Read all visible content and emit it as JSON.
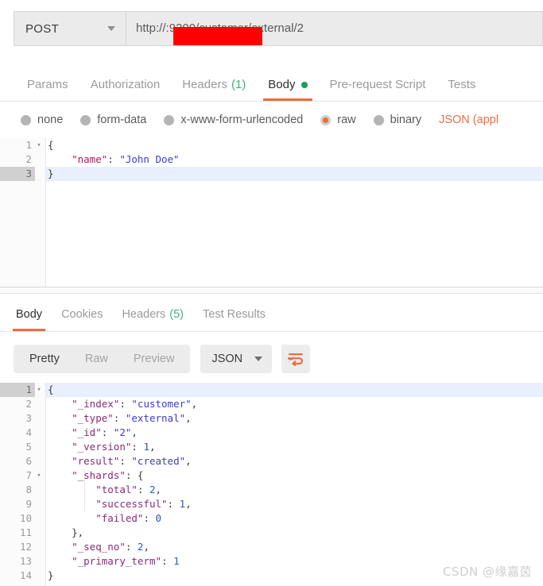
{
  "request_bar": {
    "method": "POST",
    "method_caret_icon": "chevron-down-icon",
    "url_prefix": "http://",
    "url_host_redacted": "",
    "url_suffix": ":9200/customer/external/2",
    "redaction_color": "#ff0000"
  },
  "request_tabs": [
    {
      "label": "Params",
      "active": false
    },
    {
      "label": "Authorization",
      "active": false
    },
    {
      "label": "Headers",
      "count": "(1)",
      "active": false
    },
    {
      "label": "Body",
      "dot": true,
      "active": true
    },
    {
      "label": "Pre-request Script",
      "active": false
    },
    {
      "label": "Tests",
      "active": false
    }
  ],
  "body_types": [
    {
      "label": "none",
      "checked": false
    },
    {
      "label": "form-data",
      "checked": false
    },
    {
      "label": "x-www-form-urlencoded",
      "checked": false
    },
    {
      "label": "raw",
      "checked": true
    },
    {
      "label": "binary",
      "checked": false
    }
  ],
  "body_content_type": "JSON (appl",
  "request_body": {
    "lines": [
      {
        "num": "1",
        "fold": "▾",
        "active": false,
        "tokens": [
          {
            "t": "{",
            "c": "t-punc"
          }
        ]
      },
      {
        "num": "2",
        "fold": "",
        "active": false,
        "tokens": [
          {
            "t": "    ",
            "c": "t-punc"
          },
          {
            "t": "\"name\"",
            "c": "t-key-req"
          },
          {
            "t": ": ",
            "c": "t-punc"
          },
          {
            "t": "\"John Doe\"",
            "c": "t-str-req"
          }
        ]
      },
      {
        "num": "3",
        "fold": "",
        "active": true,
        "tokens": [
          {
            "t": "}",
            "c": "t-punc"
          }
        ]
      }
    ]
  },
  "response_tabs": [
    {
      "label": "Body",
      "active": true
    },
    {
      "label": "Cookies",
      "active": false
    },
    {
      "label": "Headers",
      "count": "(5)",
      "active": false
    },
    {
      "label": "Test Results",
      "active": false
    }
  ],
  "response_toolbar": {
    "segments": [
      {
        "label": "Pretty",
        "active": true
      },
      {
        "label": "Raw",
        "active": false
      },
      {
        "label": "Preview",
        "active": false
      }
    ],
    "format": "JSON",
    "format_caret_icon": "chevron-down-icon",
    "wrap_button_icon": "word-wrap-icon",
    "wrap_icon_color": "#ef6c3f"
  },
  "response_body": {
    "lines": [
      {
        "num": "1",
        "fold": "▾",
        "active": true,
        "tokens": [
          {
            "t": "{",
            "c": "t-punc"
          }
        ]
      },
      {
        "num": "2",
        "fold": "",
        "active": false,
        "tokens": [
          {
            "t": "    ",
            "c": "t-punc"
          },
          {
            "t": "\"_index\"",
            "c": "t-key-res"
          },
          {
            "t": ": ",
            "c": "t-punc"
          },
          {
            "t": "\"customer\"",
            "c": "t-val-res"
          },
          {
            "t": ",",
            "c": "t-punc"
          }
        ]
      },
      {
        "num": "3",
        "fold": "",
        "active": false,
        "tokens": [
          {
            "t": "    ",
            "c": "t-punc"
          },
          {
            "t": "\"_type\"",
            "c": "t-key-res"
          },
          {
            "t": ": ",
            "c": "t-punc"
          },
          {
            "t": "\"external\"",
            "c": "t-val-res"
          },
          {
            "t": ",",
            "c": "t-punc"
          }
        ]
      },
      {
        "num": "4",
        "fold": "",
        "active": false,
        "tokens": [
          {
            "t": "    ",
            "c": "t-punc"
          },
          {
            "t": "\"_id\"",
            "c": "t-key-res"
          },
          {
            "t": ": ",
            "c": "t-punc"
          },
          {
            "t": "\"2\"",
            "c": "t-val-res"
          },
          {
            "t": ",",
            "c": "t-punc"
          }
        ]
      },
      {
        "num": "5",
        "fold": "",
        "active": false,
        "tokens": [
          {
            "t": "    ",
            "c": "t-punc"
          },
          {
            "t": "\"_version\"",
            "c": "t-key-res"
          },
          {
            "t": ": ",
            "c": "t-punc"
          },
          {
            "t": "1",
            "c": "t-num"
          },
          {
            "t": ",",
            "c": "t-punc"
          }
        ]
      },
      {
        "num": "6",
        "fold": "",
        "active": false,
        "tokens": [
          {
            "t": "    ",
            "c": "t-punc"
          },
          {
            "t": "\"result\"",
            "c": "t-key-res"
          },
          {
            "t": ": ",
            "c": "t-punc"
          },
          {
            "t": "\"created\"",
            "c": "t-val-res"
          },
          {
            "t": ",",
            "c": "t-punc"
          }
        ]
      },
      {
        "num": "7",
        "fold": "▾",
        "active": false,
        "tokens": [
          {
            "t": "    ",
            "c": "t-punc"
          },
          {
            "t": "\"_shards\"",
            "c": "t-key-res"
          },
          {
            "t": ": {",
            "c": "t-punc"
          }
        ]
      },
      {
        "num": "8",
        "fold": "",
        "active": false,
        "tokens": [
          {
            "t": "        ",
            "c": "t-punc"
          },
          {
            "t": "\"total\"",
            "c": "t-key-res"
          },
          {
            "t": ": ",
            "c": "t-punc"
          },
          {
            "t": "2",
            "c": "t-num"
          },
          {
            "t": ",",
            "c": "t-punc"
          }
        ]
      },
      {
        "num": "9",
        "fold": "",
        "active": false,
        "tokens": [
          {
            "t": "        ",
            "c": "t-punc"
          },
          {
            "t": "\"successful\"",
            "c": "t-key-res"
          },
          {
            "t": ": ",
            "c": "t-punc"
          },
          {
            "t": "1",
            "c": "t-num"
          },
          {
            "t": ",",
            "c": "t-punc"
          }
        ]
      },
      {
        "num": "10",
        "fold": "",
        "active": false,
        "tokens": [
          {
            "t": "        ",
            "c": "t-punc"
          },
          {
            "t": "\"failed\"",
            "c": "t-key-res"
          },
          {
            "t": ": ",
            "c": "t-punc"
          },
          {
            "t": "0",
            "c": "t-num"
          }
        ]
      },
      {
        "num": "11",
        "fold": "",
        "active": false,
        "tokens": [
          {
            "t": "    },",
            "c": "t-punc"
          }
        ]
      },
      {
        "num": "12",
        "fold": "",
        "active": false,
        "tokens": [
          {
            "t": "    ",
            "c": "t-punc"
          },
          {
            "t": "\"_seq_no\"",
            "c": "t-key-res"
          },
          {
            "t": ": ",
            "c": "t-punc"
          },
          {
            "t": "2",
            "c": "t-num"
          },
          {
            "t": ",",
            "c": "t-punc"
          }
        ]
      },
      {
        "num": "13",
        "fold": "",
        "active": false,
        "tokens": [
          {
            "t": "    ",
            "c": "t-punc"
          },
          {
            "t": "\"_primary_term\"",
            "c": "t-key-res"
          },
          {
            "t": ": ",
            "c": "t-punc"
          },
          {
            "t": "1",
            "c": "t-num"
          }
        ]
      },
      {
        "num": "14",
        "fold": "",
        "active": false,
        "tokens": [
          {
            "t": "}",
            "c": "t-punc"
          }
        ]
      }
    ]
  },
  "watermark": "CSDN @缘嘉茵"
}
